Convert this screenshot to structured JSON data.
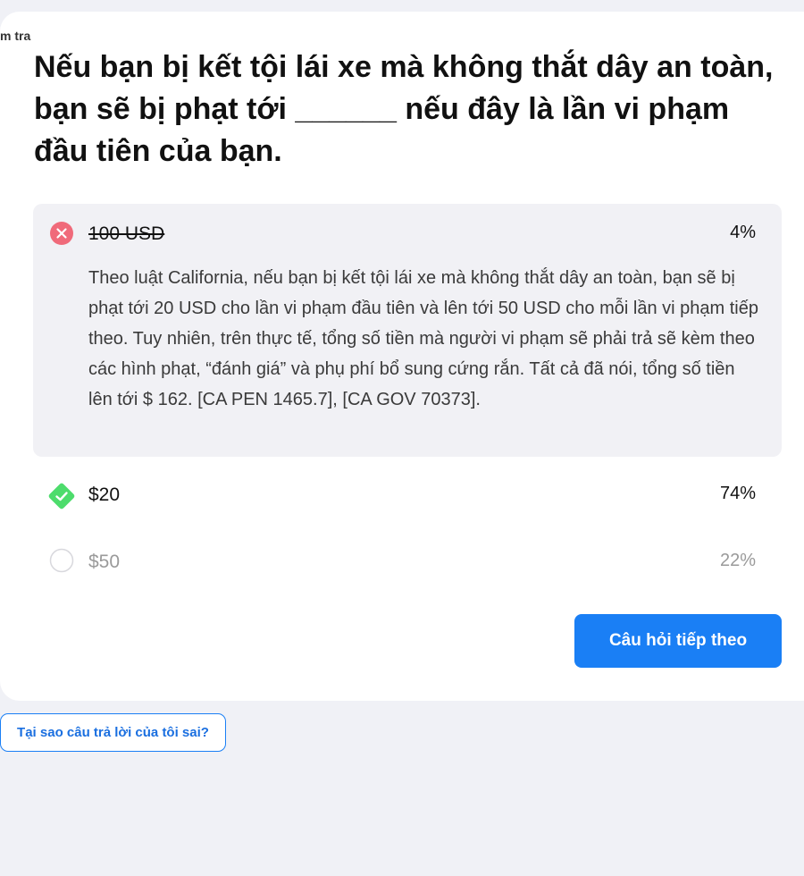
{
  "breadcrumb": "m tra",
  "question": "Nếu bạn bị kết tội lái xe mà không thắt dây an toàn, bạn sẽ bị phạt tới ______ nếu đây là lần vi phạm đầu tiên của bạn.",
  "options": [
    {
      "label": "100 USD",
      "percent": "4%",
      "state": "wrong",
      "icon": "x-circle-icon",
      "explanation": "Theo luật California, nếu bạn bị kết tội lái xe mà không thắt dây an toàn, bạn sẽ bị phạt tới 20 USD cho lần vi phạm đầu tiên và lên tới 50 USD cho mỗi lần vi phạm tiếp theo. Tuy nhiên, trên thực tế, tổng số tiền mà người vi phạm sẽ phải trả sẽ kèm theo các hình phạt, “đánh giá” và phụ phí bổ sung cứng rắn. Tất cả đã nói, tổng số tiền lên tới $ 162. [CA PEN 1465.7], [CA GOV 70373]."
    },
    {
      "label": "$20",
      "percent": "74%",
      "state": "correct",
      "icon": "check-diamond-icon"
    },
    {
      "label": "$50",
      "percent": "22%",
      "state": "unselected",
      "icon": "empty-radio-icon"
    }
  ],
  "next_button": "Câu hỏi tiếp theo",
  "why_wrong_button": "Tại sao câu trả lời của tôi sai?",
  "colors": {
    "accent": "#1a7ff5",
    "wrong": "#f06a7a",
    "correct": "#4ddc6c",
    "panel": "#f1f1f5",
    "background": "#f0f1f6"
  }
}
